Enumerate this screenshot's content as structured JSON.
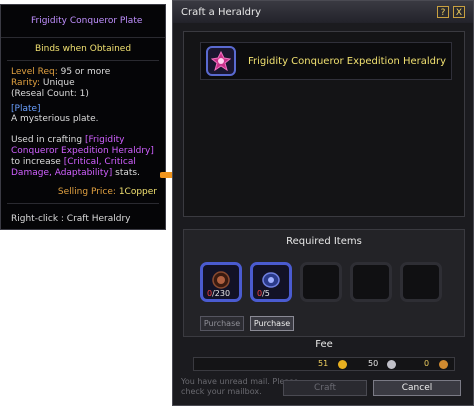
{
  "tooltip": {
    "title": "Frigidity Conqueror Plate",
    "binds": "Binds when Obtained",
    "level_label": "Level Req:",
    "level_value": " 95 or more",
    "rarity_label": "Rarity:",
    "rarity_value": " Unique",
    "reseal": "(Reseal Count: 1)",
    "type": "[Plate]",
    "desc": "A mysterious plate.",
    "craft_prefix": "Used in crafting ",
    "craft_item": "[Frigidity Conqueror Expedition Heraldry]",
    "craft_middle": " to increase ",
    "craft_stats": "[Critical, Critical Damage, Adaptability]",
    "craft_suffix": " stats.",
    "price_label": "Selling Price:",
    "price_value": " 1Copper",
    "right_click": "Right-click : Craft Heraldry"
  },
  "window": {
    "title": "Craft a Heraldry",
    "help_label": "?",
    "close_label": "X",
    "result_name": "Frigidity Conqueror Expedition Heraldry",
    "required_title": "Required Items",
    "slots": [
      {
        "owned": "0",
        "total": "/230"
      },
      {
        "owned": "0",
        "total": "/5"
      }
    ],
    "purchase_label_1": "Purchase",
    "purchase_label_2": "Purchase",
    "fee_label": "Fee",
    "fee_gold": "51",
    "fee_silver": "50",
    "fee_copper": "0",
    "bottom_text": "You have unread mail. Please check your mailbox.",
    "craft_label": "Craft",
    "cancel_label": "Cancel"
  },
  "colors": {
    "arrow": "#f0951e",
    "title_purple": "#c090ff",
    "highlight_yellow": "#f0e070"
  }
}
